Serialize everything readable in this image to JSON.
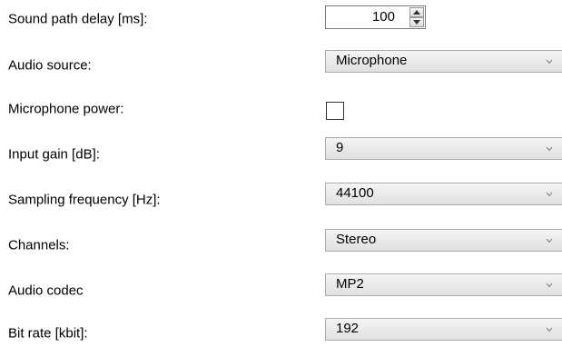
{
  "sound_delay": {
    "label": "Sound path delay [ms]:",
    "value": "100"
  },
  "audio_source": {
    "label": "Audio source:",
    "value": "Microphone"
  },
  "mic_power": {
    "label": "Microphone power:",
    "checked": false
  },
  "input_gain": {
    "label": "Input gain [dB]:",
    "value": "9"
  },
  "sampling_freq": {
    "label": "Sampling frequency [Hz]:",
    "value": "44100"
  },
  "channels": {
    "label": "Channels:",
    "value": "Stereo"
  },
  "audio_codec": {
    "label": "Audio codec",
    "value": "MP2"
  },
  "bit_rate": {
    "label": "Bit rate [kbit]:",
    "value": "192"
  },
  "icons": {
    "spinner_up": "chevron-up-icon",
    "spinner_down": "chevron-down-icon",
    "dropdown": "chevron-down-icon"
  },
  "colors": {
    "background": "#ffffff",
    "text": "#000000",
    "control_border": "#acacac",
    "arrow": "#888888"
  }
}
